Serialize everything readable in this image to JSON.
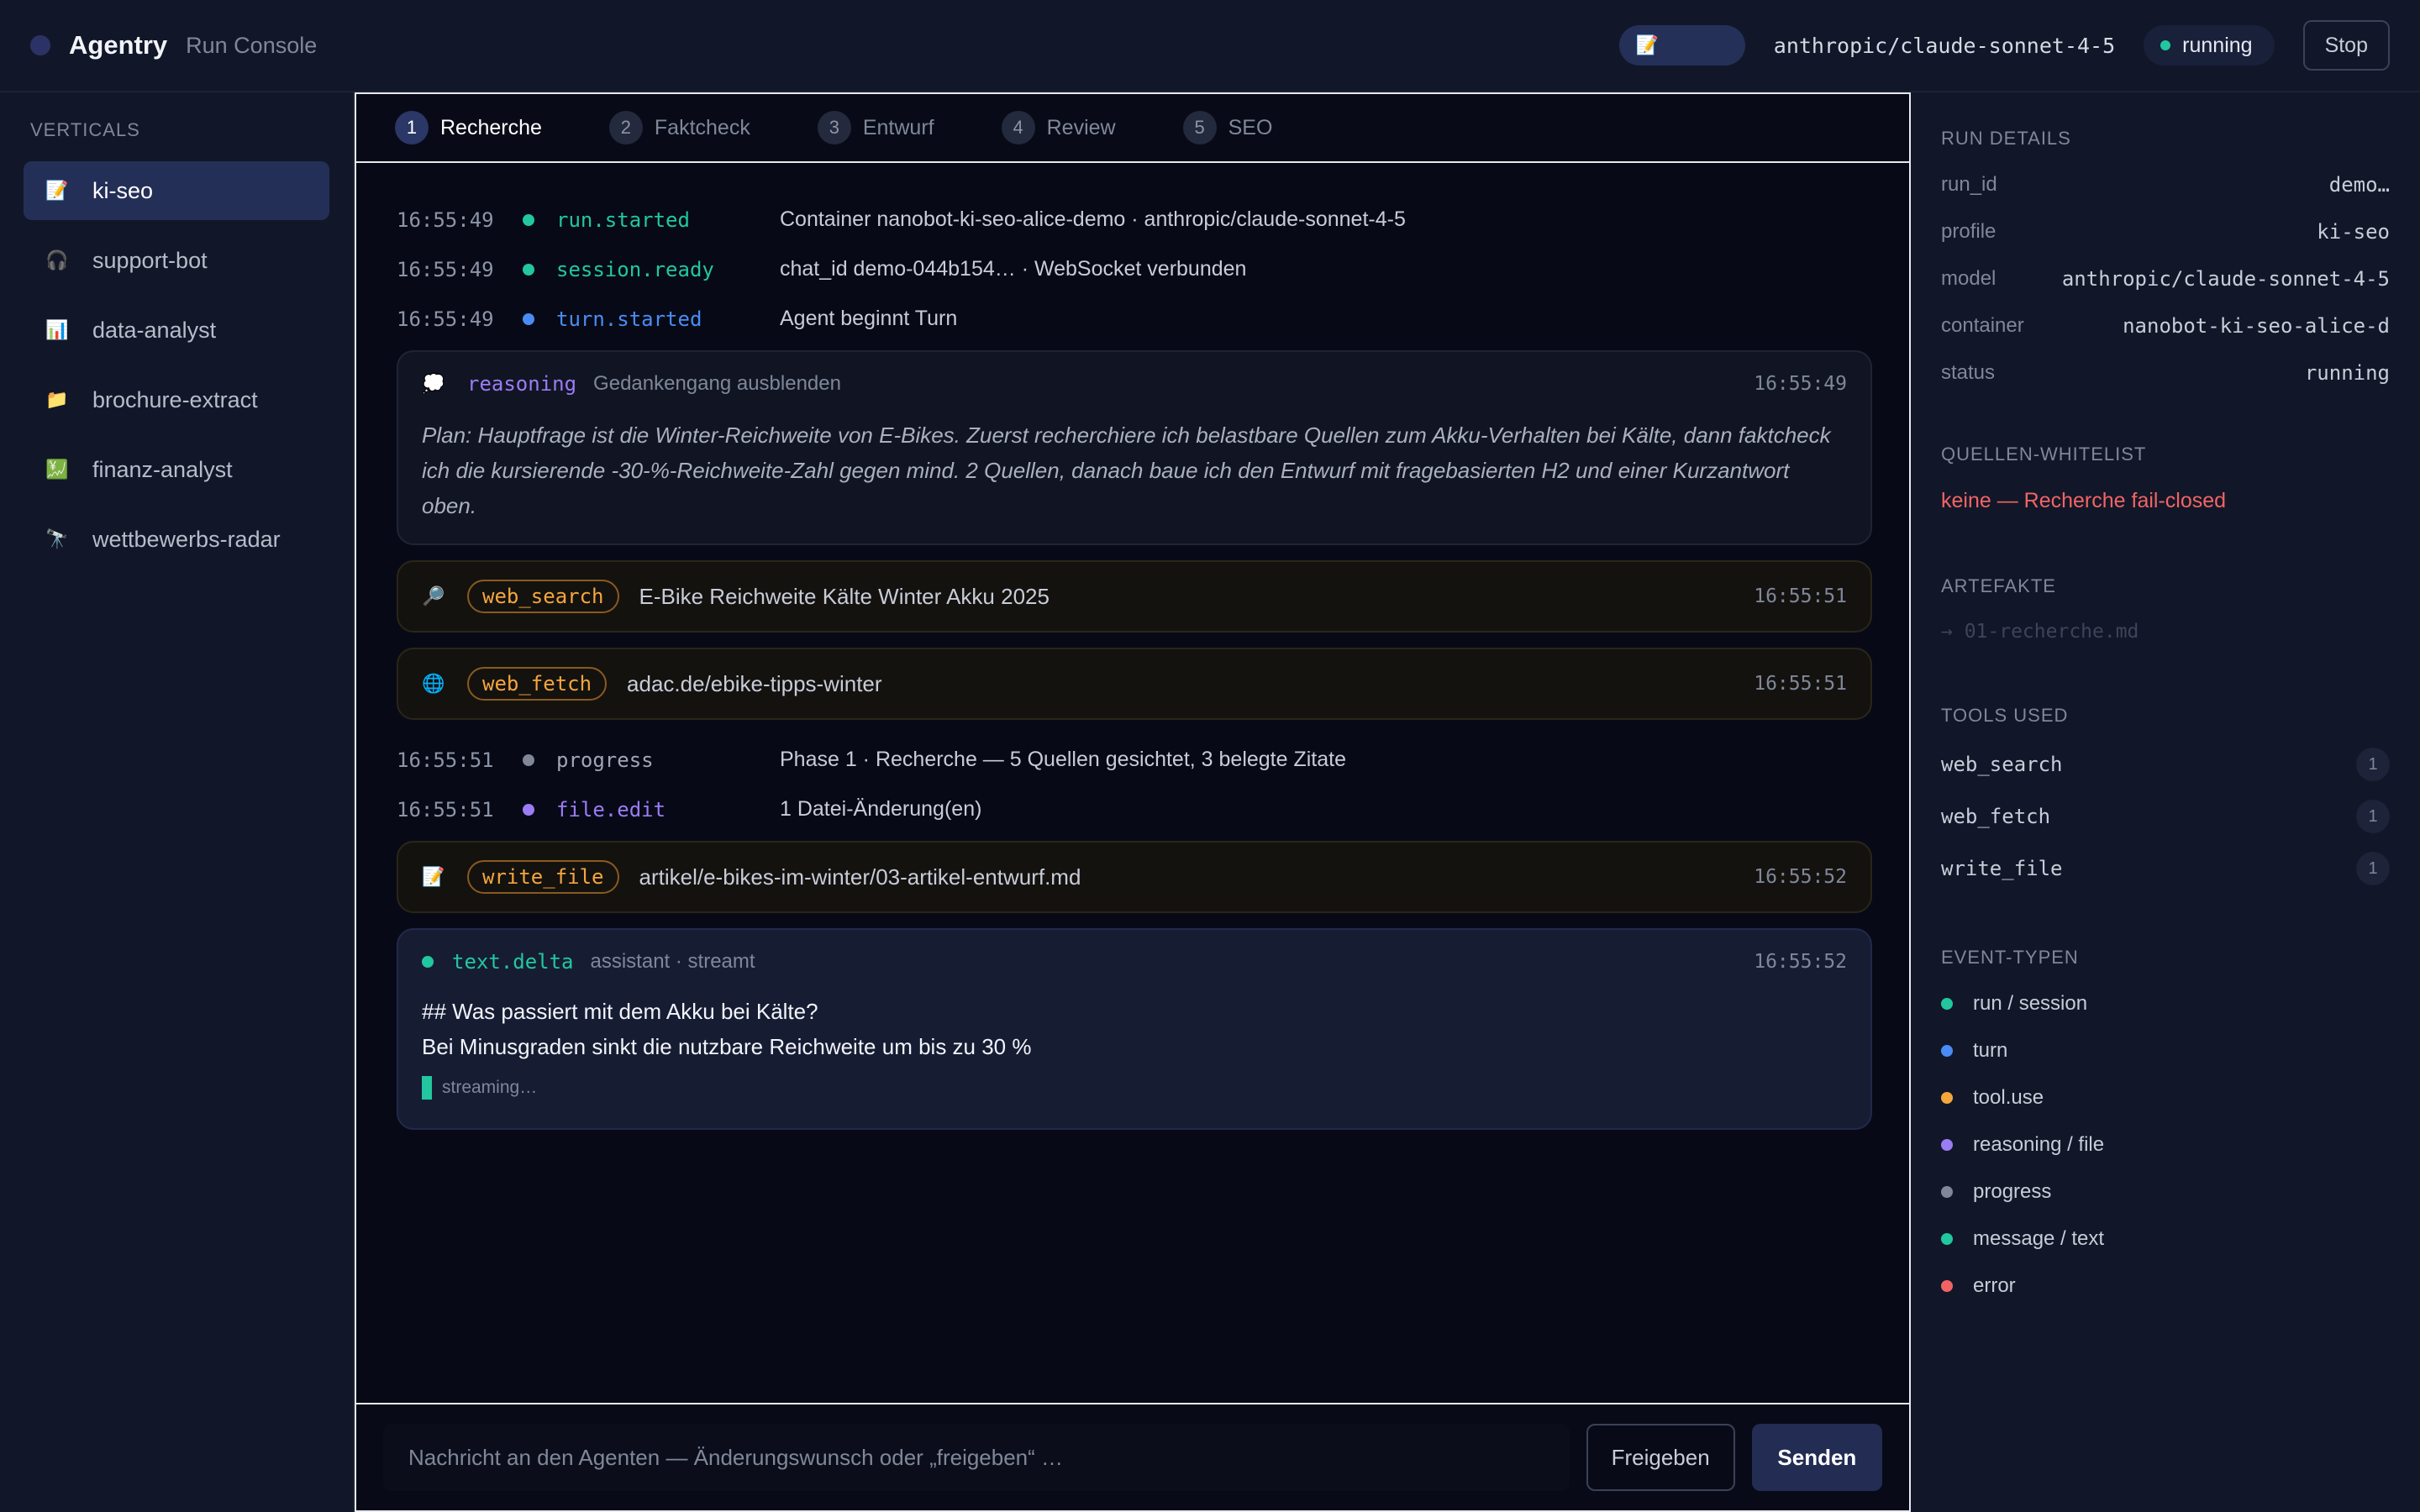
{
  "header": {
    "brand": "Agentry",
    "subtitle": "Run Console",
    "vertical_icon": "📝",
    "model": "anthropic/claude-sonnet-4-5",
    "status": "running",
    "stop_label": "Stop"
  },
  "sidebar": {
    "title": "VERTICALS",
    "items": [
      {
        "icon": "📝",
        "icon_name": "memo-icon",
        "label": "ki-seo",
        "active": true
      },
      {
        "icon": "🎧",
        "icon_name": "headphones-icon",
        "label": "support-bot"
      },
      {
        "icon": "📊",
        "icon_name": "bar-chart-icon",
        "label": "data-analyst"
      },
      {
        "icon": "📁",
        "icon_name": "folder-icon",
        "label": "brochure-extract"
      },
      {
        "icon": "💹",
        "icon_name": "chart-icon",
        "label": "finanz-analyst"
      },
      {
        "icon": "🔭",
        "icon_name": "telescope-icon",
        "label": "wettbewerbs-radar"
      }
    ]
  },
  "tabs": [
    {
      "num": "1",
      "label": "Recherche"
    },
    {
      "num": "2",
      "label": "Faktcheck"
    },
    {
      "num": "3",
      "label": "Entwurf"
    },
    {
      "num": "4",
      "label": "Review"
    },
    {
      "num": "5",
      "label": "SEO"
    }
  ],
  "events": {
    "e1": {
      "time": "16:55:49",
      "type": "run.started",
      "msg": "Container nanobot-ki-seo-alice-demo · anthropic/claude-sonnet-4-5"
    },
    "e2": {
      "time": "16:55:49",
      "type": "session.ready",
      "msg": "chat_id demo-044b154… · WebSocket verbunden"
    },
    "e3": {
      "time": "16:55:49",
      "type": "turn.started",
      "msg": "Agent beginnt Turn"
    },
    "reasoning": {
      "icon": "💭",
      "type": "reasoning",
      "toggle": "Gedankengang ausblenden",
      "time": "16:55:49",
      "text": "Plan: Hauptfrage ist die Winter-Reichweite von E-Bikes. Zuerst recherchiere ich belastbare Quellen zum Akku-Verhalten bei Kälte, dann faktcheck ich die kursierende -30-%-Reichweite-Zahl gegen mind. 2 Quellen, danach baue ich den Entwurf mit fragebasierten H2 und einer Kurzantwort oben."
    },
    "tool1": {
      "icon": "🔎",
      "tool": "web_search",
      "msg": "E-Bike Reichweite Kälte Winter Akku 2025",
      "time": "16:55:51"
    },
    "tool2": {
      "icon": "🌐",
      "tool": "web_fetch",
      "msg": "adac.de/ebike-tipps-winter",
      "time": "16:55:51"
    },
    "e4": {
      "time": "16:55:51",
      "type": "progress",
      "msg": "Phase 1 · Recherche — 5 Quellen gesichtet, 3 belegte Zitate"
    },
    "e5": {
      "time": "16:55:51",
      "type": "file.edit",
      "msg": "1 Datei-Änderung(en)"
    },
    "tool3": {
      "icon": "📝",
      "tool": "write_file",
      "msg": "artikel/e-bikes-im-winter/03-artikel-entwurf.md",
      "time": "16:55:52"
    },
    "delta": {
      "type": "text.delta",
      "sub": "assistant · streamt",
      "time": "16:55:52",
      "line1": "## Was passiert mit dem Akku bei Kälte?",
      "line2": "Bei Minusgraden sinkt die nutzbare Reichweite um bis zu 30 %",
      "streaming": "streaming…"
    }
  },
  "composer": {
    "placeholder": "Nachricht an den Agenten — Änderungswunsch oder „freigeben“ …",
    "approve_label": "Freigeben",
    "send_label": "Senden"
  },
  "run_details": {
    "title": "RUN DETAILS",
    "rows": [
      {
        "k": "run_id",
        "v": "demo…"
      },
      {
        "k": "profile",
        "v": "ki-seo"
      },
      {
        "k": "model",
        "v": "anthropic/claude-sonnet-4-5"
      },
      {
        "k": "container",
        "v": "nanobot-ki-seo-alice-d"
      },
      {
        "k": "status",
        "v": "running"
      }
    ]
  },
  "whitelist": {
    "title": "QUELLEN-WHITELIST",
    "text": "keine — Recherche fail-closed"
  },
  "artifacts": {
    "title": "ARTEFAKTE",
    "item": "→ 01-recherche.md"
  },
  "tools_used": {
    "title": "TOOLS USED",
    "rows": [
      {
        "name": "web_search",
        "count": "1"
      },
      {
        "name": "web_fetch",
        "count": "1"
      },
      {
        "name": "write_file",
        "count": "1"
      }
    ]
  },
  "event_types": {
    "title": "EVENT-TYPEN",
    "rows": [
      {
        "label": "run / session",
        "color": "#22c7a0"
      },
      {
        "label": "turn",
        "color": "#4a8cf5"
      },
      {
        "label": "tool.use",
        "color": "#f5a63c"
      },
      {
        "label": "reasoning / file",
        "color": "#9b7cf5"
      },
      {
        "label": "progress",
        "color": "#7f8799"
      },
      {
        "label": "message / text",
        "color": "#22c7a0"
      },
      {
        "label": "error",
        "color": "#f26464"
      }
    ]
  },
  "colors": {
    "run": "#22c7a0",
    "turn": "#4a8cf5",
    "tool": "#f5a63c",
    "reasoning": "#9b7cf5",
    "progress": "#7f8799",
    "error": "#f26464"
  }
}
